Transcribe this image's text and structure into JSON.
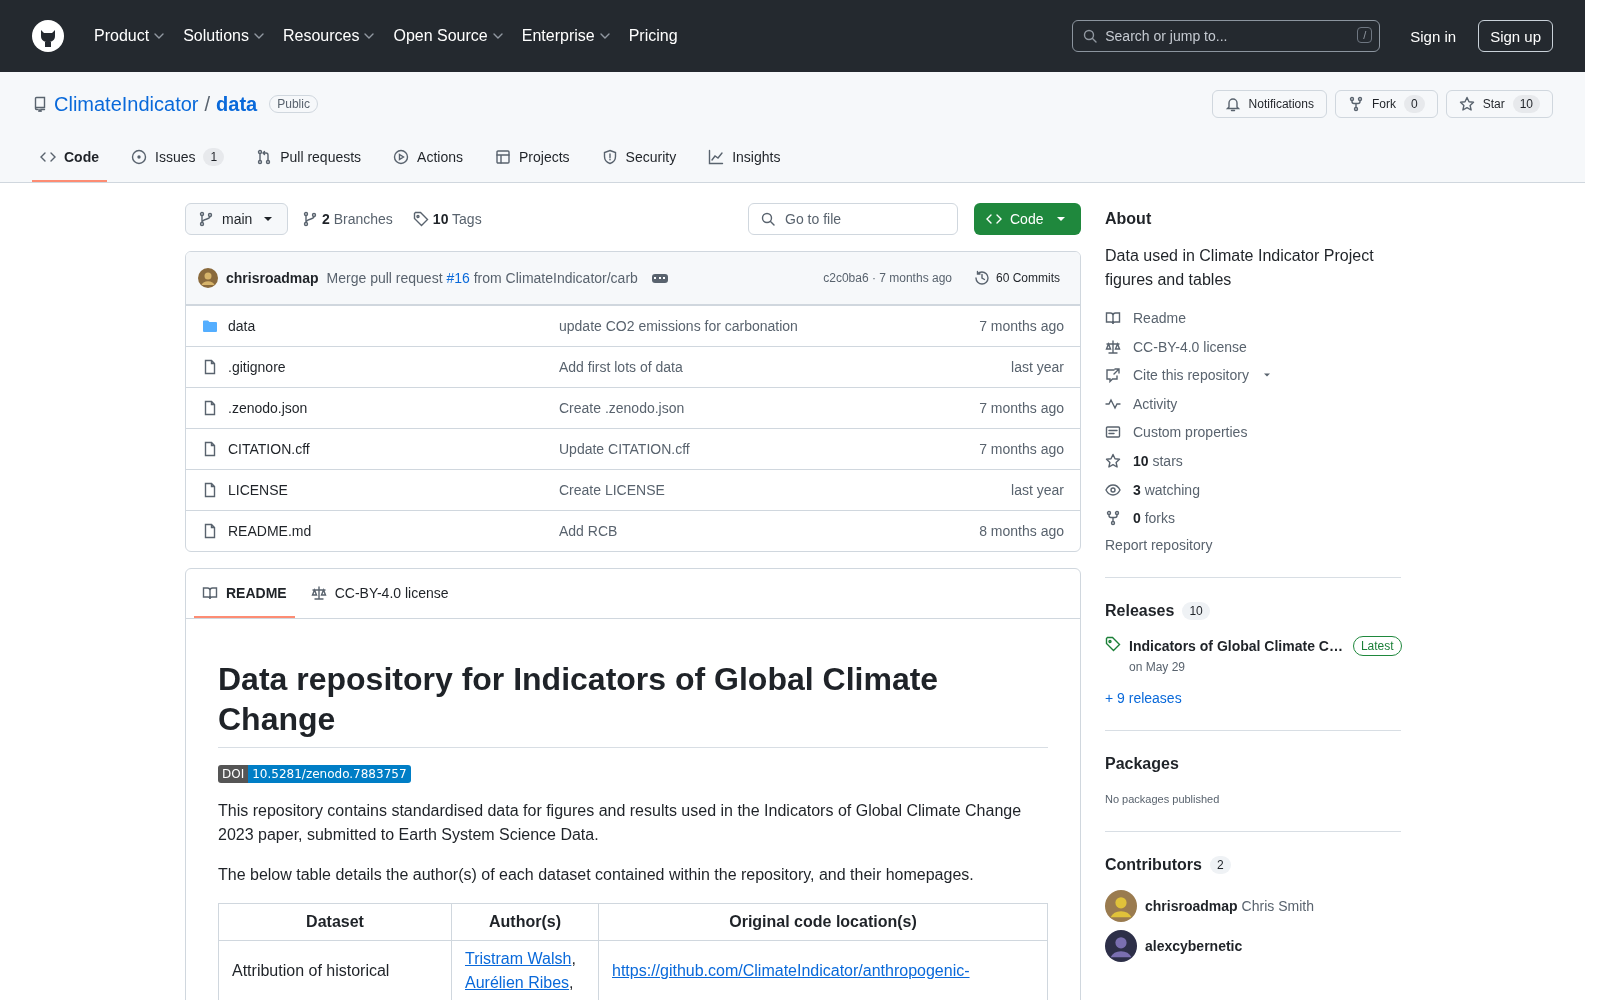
{
  "header": {
    "nav": [
      {
        "label": "Product",
        "dropdown": true
      },
      {
        "label": "Solutions",
        "dropdown": true
      },
      {
        "label": "Resources",
        "dropdown": true
      },
      {
        "label": "Open Source",
        "dropdown": true
      },
      {
        "label": "Enterprise",
        "dropdown": true
      },
      {
        "label": "Pricing",
        "dropdown": false
      }
    ],
    "search": {
      "placeholder": "Search or jump to...",
      "shortcut": "/"
    },
    "sign_in": "Sign in",
    "sign_up": "Sign up"
  },
  "repo": {
    "owner": "ClimateIndicator",
    "separator": "/",
    "name": "data",
    "visibility": "Public",
    "actions": [
      {
        "kind": "notifications",
        "label": "Notifications"
      },
      {
        "kind": "fork",
        "label": "Fork",
        "count": "0"
      },
      {
        "kind": "star",
        "label": "Star",
        "count": "10"
      }
    ]
  },
  "tabs": [
    {
      "kind": "code",
      "label": "Code",
      "selected": true
    },
    {
      "kind": "issues",
      "label": "Issues",
      "count": "1",
      "selected": false
    },
    {
      "kind": "pulls",
      "label": "Pull requests",
      "selected": false
    },
    {
      "kind": "actions",
      "label": "Actions",
      "selected": false
    },
    {
      "kind": "projects",
      "label": "Projects",
      "selected": false
    },
    {
      "kind": "security",
      "label": "Security",
      "selected": false
    },
    {
      "kind": "insights",
      "label": "Insights",
      "selected": false
    }
  ],
  "toolbar": {
    "branch": "main",
    "branches": "**2** Branches",
    "tags": "**10** Tags",
    "go_to_file": {
      "placeholder": "Go to file"
    },
    "code_button": "Code"
  },
  "latest_commit": {
    "author": "chrisroadmap",
    "message_before": "Merge pull request ",
    "link": "#16",
    "message_after": " from ClimateIndicator/carb",
    "hash_time": "c2c0ba6 · 7 months ago",
    "commits": "60 Commits"
  },
  "files": [
    {
      "kind": "folder",
      "name": "data",
      "message": "update CO2 emissions for carbonation",
      "time": "7 months ago"
    },
    {
      "kind": "file",
      "name": ".gitignore",
      "message": "Add first lots of data",
      "time": "last year"
    },
    {
      "kind": "file",
      "name": ".zenodo.json",
      "message": "Create .zenodo.json",
      "time": "7 months ago"
    },
    {
      "kind": "file",
      "name": "CITATION.cff",
      "message": "Update CITATION.cff",
      "time": "7 months ago"
    },
    {
      "kind": "file",
      "name": "LICENSE",
      "message": "Create LICENSE",
      "time": "last year"
    },
    {
      "kind": "file",
      "name": "README.md",
      "message": "Add RCB",
      "time": "8 months ago"
    }
  ],
  "readme": {
    "tabs": [
      {
        "kind": "readme",
        "label": "README",
        "selected": true
      },
      {
        "kind": "license",
        "label": "CC-BY-4.0 license",
        "selected": false
      }
    ],
    "title": "Data repository for Indicators of Global Climate Change",
    "badge": {
      "label": "DOI",
      "value": "10.5281/zenodo.7883757"
    },
    "paragraphs": [
      "This repository contains standardised data for figures and results used in the Indicators of Global Climate Change 2023 paper, submitted to Earth System Science Data.",
      "The below table details the author(s) of each dataset contained within the repository, and their homepages."
    ],
    "table": {
      "columns": [
        "Dataset",
        "Author(s)",
        "Original code location(s)"
      ],
      "rows": [
        {
          "dataset": "Attribution of historical",
          "authors": [
            {
              "name": "Tristram Walsh",
              "after": ","
            },
            {
              "name": "Aurélien Ribes",
              "after": ","
            }
          ],
          "code_location": "https://github.com/ClimateIndicator/anthropogenic-"
        }
      ]
    }
  },
  "sidebar": {
    "about": {
      "heading": "About",
      "description": "Data used in Climate Indicator Project figures and tables",
      "links": [
        {
          "kind": "readme",
          "label": "Readme",
          "dropdown": false
        },
        {
          "kind": "license",
          "label": "CC-BY-4.0 license",
          "dropdown": false
        },
        {
          "kind": "cite",
          "label": "Cite this repository",
          "dropdown": true
        },
        {
          "kind": "activity",
          "label": "Activity",
          "dropdown": false
        },
        {
          "kind": "properties",
          "label": "Custom properties",
          "dropdown": false
        },
        {
          "kind": "stars",
          "label": "**10** stars",
          "dropdown": false
        },
        {
          "kind": "watching",
          "label": "**3** watching",
          "dropdown": false
        },
        {
          "kind": "forks",
          "label": "**0** forks",
          "dropdown": false
        }
      ],
      "report": "Report repository"
    },
    "releases": {
      "heading": "Releases",
      "count": "10",
      "latest": {
        "name": "Indicators of Global Climate C…",
        "badge": "Latest",
        "date": "on May 29"
      },
      "more": "+ 9 releases"
    },
    "packages": {
      "heading": "Packages",
      "note": "No packages published"
    },
    "contributors": {
      "heading": "Contributors",
      "count": "2",
      "people": [
        {
          "login": "chrisroadmap",
          "name": "Chris Smith"
        },
        {
          "login": "alexcybernetic"
        }
      ]
    }
  }
}
